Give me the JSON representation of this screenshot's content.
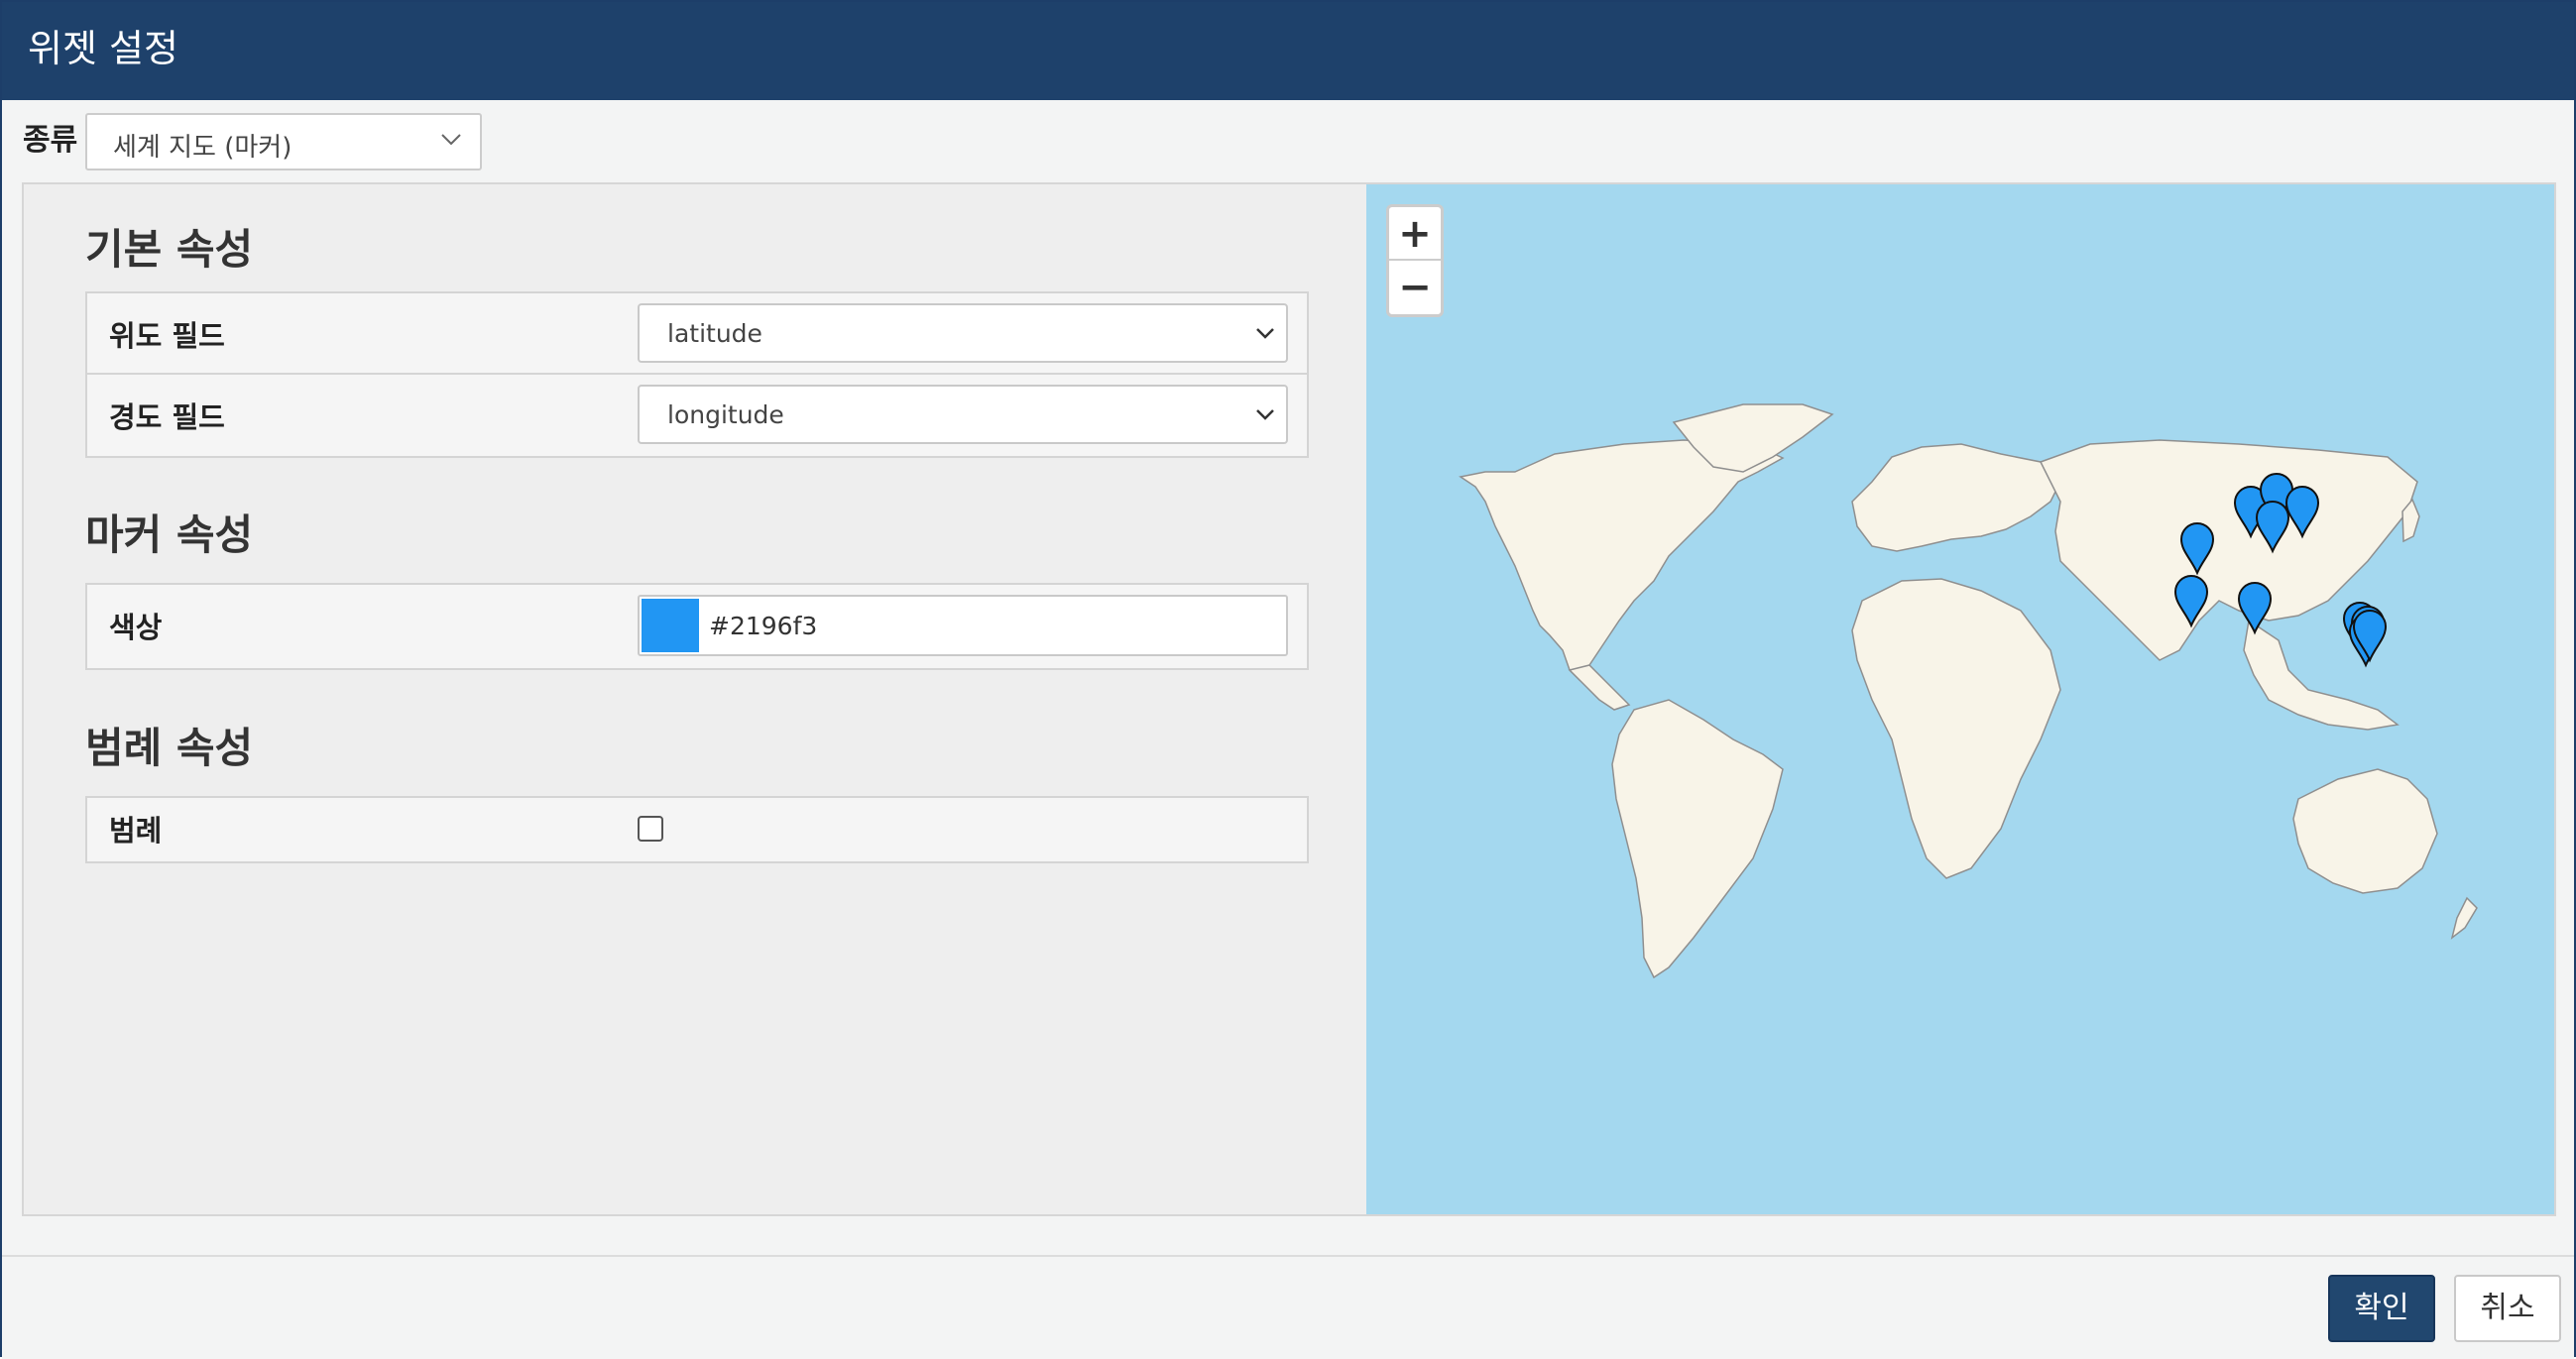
{
  "window": {
    "title": "위젯 설정"
  },
  "kind": {
    "label": "종류",
    "value": "세계 지도 (마커)"
  },
  "sections": {
    "basic": {
      "title": "기본 속성",
      "lat_label": "위도 필드",
      "lat_value": "latitude",
      "lng_label": "경도 필드",
      "lng_value": "longitude"
    },
    "marker": {
      "title": "마커 속성",
      "color_label": "색상",
      "color_value": "#2196f3"
    },
    "legend": {
      "title": "범례 속성",
      "legend_label": "범례",
      "legend_checked": false
    }
  },
  "map": {
    "zoom_in": "+",
    "zoom_out": "−",
    "marker_color": "#2196f3",
    "ocean_color": "#a4d8ef",
    "land_color": "#f8f4e8"
  },
  "footer": {
    "ok_label": "확인",
    "cancel_label": "취소"
  },
  "colors": {
    "header": "#1e416b",
    "ok_button": "#21476f"
  }
}
